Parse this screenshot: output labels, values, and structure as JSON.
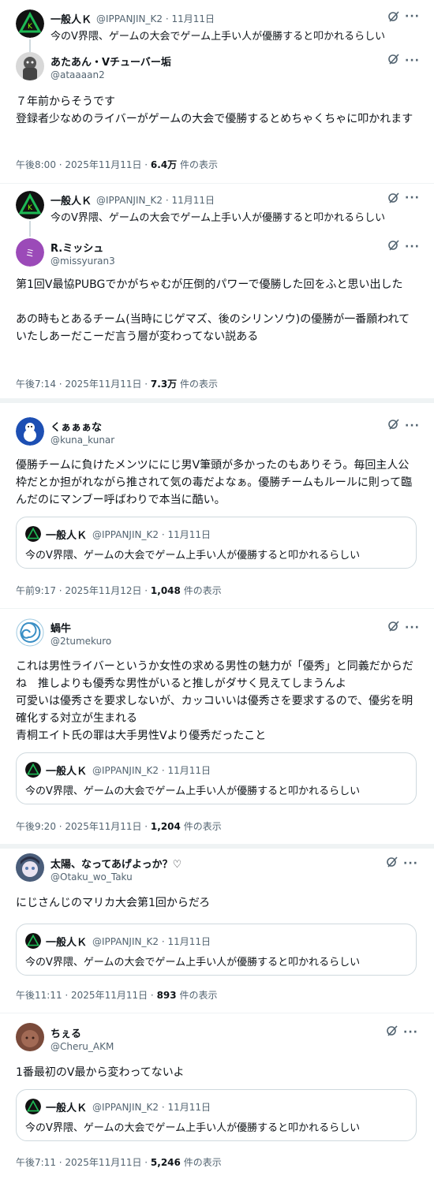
{
  "original": {
    "name": "一般人Ｋ",
    "handle": "@IPPANJIN_K2",
    "date": "11月11日",
    "text": "今のV界隈、ゲームの大会でゲーム上手い人が優勝すると叩かれるらしい"
  },
  "replies": [
    {
      "name": "あたあん・Vチューバー垢",
      "handle": "@ataaaan2",
      "text": "７年前からそうです\n登録者少なめのライバーがゲームの大会で優勝するとめちゃくちゃに叩かれます",
      "time": "午後8:00 · 2025年11月11日 · ",
      "views": "6.4万",
      "views_suffix": " 件の表示"
    },
    {
      "name": "R.ミッシュ",
      "handle": "@missyuran3",
      "text": "第1回V最協PUBGでかがちゃむが圧倒的パワーで優勝した回をふと思い出した\n\nあの時もとあるチーム(当時にじゲマズ、後のシリンソウ)の優勝が一番願われていたしあーだこーだ言う層が変わってない説ある",
      "time": "午後7:14 · 2025年11月11日 · ",
      "views": "7.3万",
      "views_suffix": " 件の表示"
    },
    {
      "name": "くぁぁぁな",
      "handle": "@kuna_kunar",
      "text": "優勝チームに負けたメンツににじ男V筆頭が多かったのもありそう。毎回主人公枠だとか担がれながら推されて気の毒だよなぁ。優勝チームもルールに則って臨んだのにマンブー呼ばわりで本当に酷い。",
      "time": "午前9:17 · 2025年11月12日 · ",
      "views": "1,048",
      "views_suffix": " 件の表示"
    },
    {
      "name": "蝸牛",
      "handle": "@2tumekuro",
      "text": "これは男性ライバーというか女性の求める男性の魅力が「優秀」と同義だからだね　推しよりも優秀な男性がいると推しがダサく見えてしまうんよ\n可愛いは優秀さを要求しないが、カッコいいは優秀さを要求するので、優劣を明確化する対立が生まれる\n青桐エイト氏の罪は大手男性Vより優秀だったこと",
      "time": "午後9:20 · 2025年11月11日 · ",
      "views": "1,204",
      "views_suffix": " 件の表示"
    },
    {
      "name": "太陽、なってあげよっか？♡",
      "handle": "@Otaku_wo_Taku",
      "text": "にじさんじのマリカ大会第1回からだろ",
      "time": "午後11:11 · 2025年11月11日 · ",
      "views": "893",
      "views_suffix": " 件の表示"
    },
    {
      "name": "ちぇる",
      "handle": "@Cheru_AKM",
      "text": "1番最初のV最から変わってないよ",
      "time": "午後7:11 · 2025年11月11日 · ",
      "views": "5,246",
      "views_suffix": " 件の表示"
    }
  ],
  "more_label": "···",
  "colors": {
    "text": "#0f1419",
    "secondary": "#536471",
    "border": "#cfd9de",
    "divider": "#eff3f4"
  }
}
